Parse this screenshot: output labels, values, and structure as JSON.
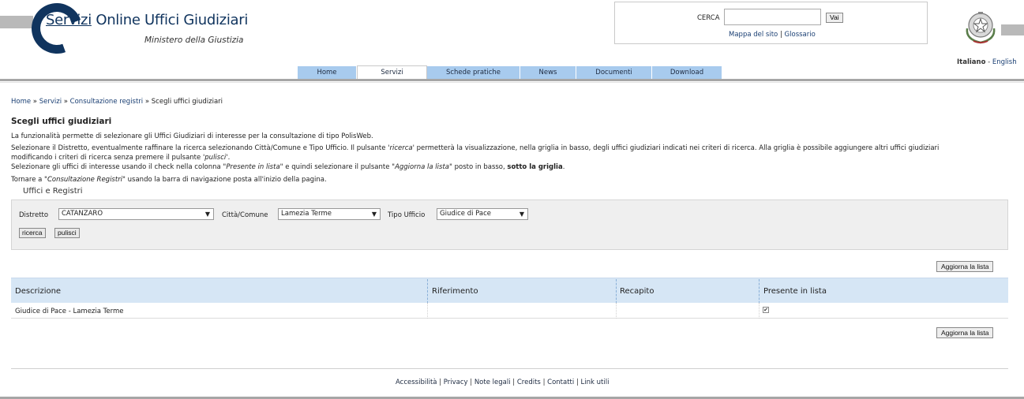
{
  "header": {
    "title_underlined": "Servizi",
    "title_rest": " Online",
    "title_highlight": " Uffici Giudiziari",
    "subtitle": "Ministero della Giustizia",
    "search_label": "CERCA",
    "search_value": "",
    "search_button": "Vai",
    "links": [
      "Mappa del sito",
      "Glossario"
    ],
    "link_sep": "|",
    "lang_current": "Italiano",
    "lang_sep": " - ",
    "lang_other": "English"
  },
  "nav": {
    "tabs": [
      "Home",
      "Servizi",
      "Schede pratiche",
      "News",
      "Documenti",
      "Download"
    ],
    "active": "Servizi"
  },
  "breadcrumb": {
    "items": [
      "Home",
      "Servizi",
      "Consultazione registri"
    ],
    "current": "Scegli uffici giudiziari",
    "sep": " » "
  },
  "page": {
    "title": "Scegli uffici giudiziari",
    "intro": "La funzionalità permette di selezionare gli Uffici Giudiziari di interesse per la consultazione di tipo PolisWeb.",
    "p2_a": "Selezionare il Distretto, eventualmente raffinare la ricerca selezionando Città/Comune e Tipo Ufficio. Il pulsante '",
    "p2_b": "ricerca",
    "p2_c": "' permetterà la visualizzazione, nella griglia in basso, degli uffici giudiziari indicati nei criteri di ricerca. Alla griglia è possibile aggiungere altri uffici giudiziari",
    "p3_a": "modificando i criteri di ricerca senza premere il pulsante '",
    "p3_b": "pulisci",
    "p3_c": "'.",
    "p4_a": "Selezionare gli uffici di interesse usando il check nella colonna \"",
    "p4_b": "Presente in lista",
    "p4_c": "\" e quindi selezionare il pulsante \"",
    "p4_d": "Aggiorna la lista",
    "p4_e": "\" posto in basso, ",
    "p4_f": "sotto la griglia",
    "p4_g": ".",
    "p5_a": "Tornare a \"",
    "p5_b": "Consultazione Registri",
    "p5_c": "\" usando la barra di navigazione posta all'inizio della pagina."
  },
  "filters": {
    "legend": "Uffici e Registri",
    "distretto_label": "Distretto",
    "distretto_value": "CATANZARO",
    "citta_label": "Città/Comune",
    "citta_value": "Lamezia Terme",
    "tipo_label": "Tipo Ufficio",
    "tipo_value": "Giudice di Pace",
    "search_button": "ricerca",
    "clear_button": "pulisci"
  },
  "grid": {
    "update_button": "Aggiorna la lista",
    "columns": [
      "Descrizione",
      "Riferimento",
      "Recapito",
      "Presente in lista"
    ],
    "rows": [
      {
        "descrizione": "Giudice di Pace - Lamezia Terme",
        "riferimento": "",
        "recapito": "",
        "presente": true
      }
    ]
  },
  "footer": {
    "links": [
      "Accessibilità",
      "Privacy",
      "Note legali",
      "Credits",
      "Contatti",
      "Link utili"
    ],
    "sep": "|"
  }
}
